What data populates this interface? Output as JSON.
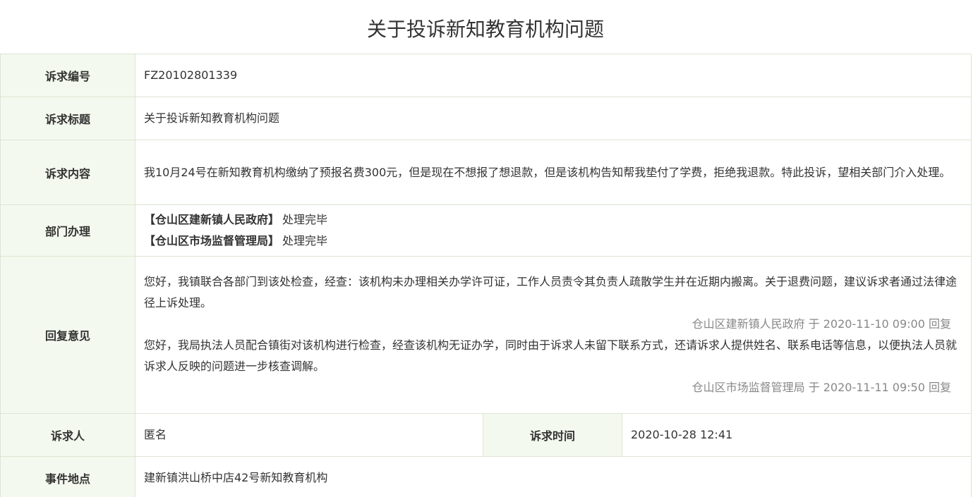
{
  "page_title": "关于投诉新知教育机构问题",
  "labels": {
    "case_no": "诉求编号",
    "case_title": "诉求标题",
    "case_content": "诉求内容",
    "departments": "部门办理",
    "replies": "回复意见",
    "complainant": "诉求人",
    "complaint_time": "诉求时间",
    "location": "事件地点"
  },
  "values": {
    "case_no": "FZ20102801339",
    "case_title": "关于投诉新知教育机构问题",
    "case_content": "我10月24号在新知教育机构缴纳了预报名费300元，但是现在不想报了想退款，但是该机构告知帮我垫付了学费，拒绝我退款。特此投诉，望相关部门介入处理。",
    "complainant": "匿名",
    "complaint_time": "2020-10-28 12:41",
    "location": "建新镇洪山桥中店42号新知教育机构"
  },
  "departments": [
    {
      "name": "【仓山区建新镇人民政府】",
      "status": "处理完毕"
    },
    {
      "name": "【仓山区市场监督管理局】",
      "status": "处理完毕"
    }
  ],
  "replies": [
    {
      "text": "您好，我镇联合各部门到该处检查，经查：该机构未办理相关办学许可证，工作人员责令其负责人疏散学生并在近期内搬离。关于退费问题，建议诉求者通过法律途径上诉处理。",
      "signature": "仓山区建新镇人民政府 于 2020-11-10 09:00 回复"
    },
    {
      "text": "您好，我局执法人员配合镇街对该机构进行检查，经查该机构无证办学，同时由于诉求人未留下联系方式，还请诉求人提供姓名、联系电话等信息，以便执法人员就诉求人反映的问题进一步核查调解。",
      "signature": "仓山区市场监督管理局 于 2020-11-11 09:50 回复"
    }
  ],
  "colors": {
    "label_bg": "#f3f9ee",
    "label_text": "#6aa44a",
    "border": "#dde5d3",
    "signature_text": "#888888"
  }
}
